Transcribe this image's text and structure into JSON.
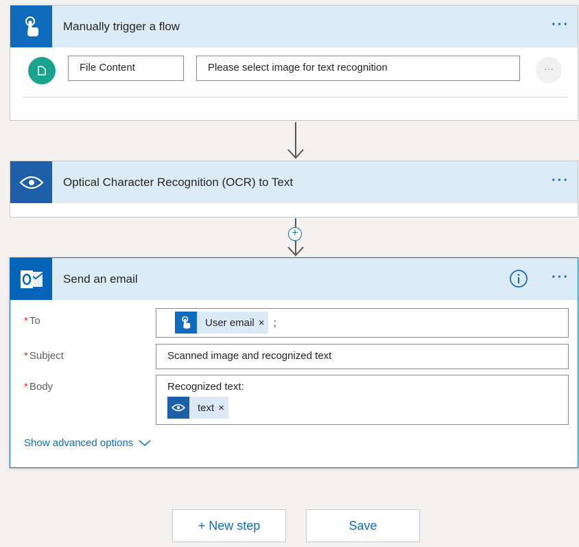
{
  "trigger": {
    "title": "Manually trigger a flow",
    "more": "···",
    "field_name": "File Content",
    "field_prompt": "Please select image for text recognition",
    "field_more": "···"
  },
  "ocr": {
    "title": "Optical Character Recognition (OCR) to Text",
    "more": "···"
  },
  "add_step_symbol": "+",
  "email": {
    "title": "Send an email",
    "more": "···",
    "required_mark": "*",
    "to_label": "To",
    "to_token": "User email",
    "token_remove": "×",
    "to_separator": ";",
    "subject_label": "Subject",
    "subject_value": "Scanned image and recognized text",
    "body_label": "Body",
    "body_text": "Recognized text:",
    "body_token": "text",
    "advanced_link": "Show advanced options"
  },
  "footer": {
    "new_step": "+ New step",
    "save": "Save"
  },
  "colors": {
    "accent": "#0f6cbd",
    "header_bg": "#ddebf7",
    "required": "#d13438",
    "avatar": "#1aa38f"
  },
  "icons": {
    "trigger": "hand-touch-icon",
    "ocr": "eye-icon",
    "email": "outlook-icon",
    "info": "info-icon",
    "file": "file-icon",
    "chevron": "chevron-down-icon"
  }
}
